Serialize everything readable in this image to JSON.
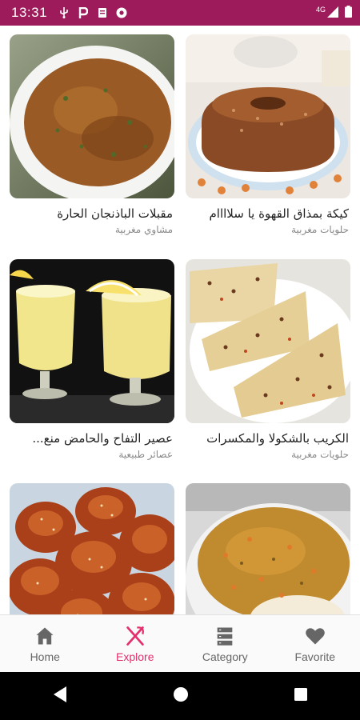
{
  "status_bar": {
    "time": "13:31",
    "network": "4G",
    "background_color": "#9d1b5a"
  },
  "recipes": [
    {
      "title": "مقبلات الباذنجان الحارة",
      "category": "مشاوي مغربية",
      "image": "spicy-eggplant-dish"
    },
    {
      "title": "كيكة بمذاق القهوة يا سلاااام",
      "category": "حلويات مغربية",
      "image": "coffee-bundt-cake"
    },
    {
      "title": "عصير التفاح والحامض منع...",
      "category": "عصائر طبيعية",
      "image": "apple-lemon-juice-glasses"
    },
    {
      "title": "الكريب بالشكولا والمكسرات",
      "category": "حلويات مغربية",
      "image": "chocolate-nut-crepes"
    },
    {
      "title": "",
      "category": "",
      "image": "sesame-buns"
    },
    {
      "title": "",
      "category": "",
      "image": "rice-with-vegetables"
    }
  ],
  "bottom_nav": {
    "active_color": "#e3306c",
    "items": [
      {
        "label": "Home",
        "icon": "home-icon",
        "active": false
      },
      {
        "label": "Explore",
        "icon": "fork-knife-icon",
        "active": true
      },
      {
        "label": "Category",
        "icon": "category-list-icon",
        "active": false
      },
      {
        "label": "Favorite",
        "icon": "heart-icon",
        "active": false
      }
    ]
  }
}
